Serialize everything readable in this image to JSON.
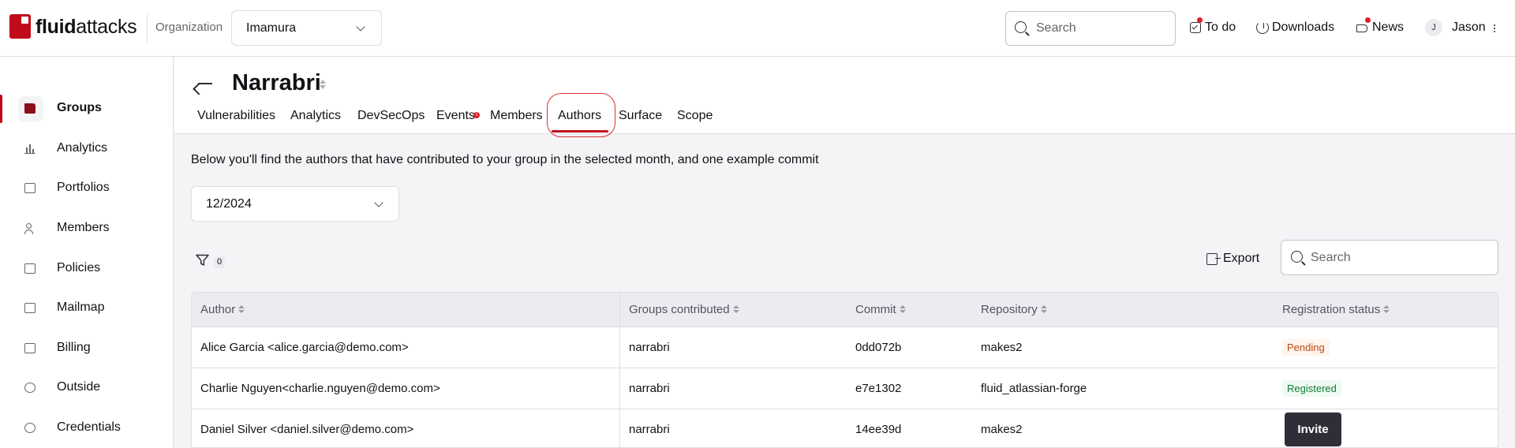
{
  "topbar": {
    "logo_bold": "fluid",
    "logo_light": "attacks",
    "org_label": "Organization",
    "org_value": "Imamura",
    "search_placeholder": "Search",
    "todo_label": "To do",
    "downloads_label": "Downloads",
    "news_label": "News",
    "user_initial": "J",
    "user_name": "Jason"
  },
  "sidebar": {
    "items": [
      {
        "label": "Groups",
        "icon": "folder-icon"
      },
      {
        "label": "Analytics",
        "icon": "bar-chart-icon"
      },
      {
        "label": "Portfolios",
        "icon": "briefcase-icon"
      },
      {
        "label": "Members",
        "icon": "user-plus-icon"
      },
      {
        "label": "Policies",
        "icon": "document-icon"
      },
      {
        "label": "Mailmap",
        "icon": "mail-icon"
      },
      {
        "label": "Billing",
        "icon": "credit-card-icon"
      },
      {
        "label": "Outside",
        "icon": "info-icon"
      },
      {
        "label": "Credentials",
        "icon": "key-icon"
      }
    ]
  },
  "group": {
    "title": "Narrabri",
    "tabs": [
      "Vulnerabilities",
      "Analytics",
      "DevSecOps",
      "Events",
      "Members",
      "Authors",
      "Surface",
      "Scope"
    ],
    "active_tab": "Authors",
    "events_badge": "1"
  },
  "authors": {
    "description": "Below you'll find the authors that have contributed to your group in the selected month, and one example commit",
    "month": "12/2024",
    "filter_count": "0",
    "export_label": "Export",
    "search_placeholder": "Search",
    "columns": [
      "Author",
      "Groups contributed",
      "Commit",
      "Repository",
      "Registration status"
    ],
    "rows": [
      {
        "author": "Alice Garcia <alice.garcia@demo.com>",
        "groups": "narrabri",
        "commit": "0dd072b",
        "repository": "makes2",
        "status": "Pending"
      },
      {
        "author": "Charlie Nguyen<charlie.nguyen@demo.com>",
        "groups": "narrabri",
        "commit": "e7e1302",
        "repository": "fluid_atlassian-forge",
        "status": "Registered"
      },
      {
        "author": "Daniel Silver <daniel.silver@demo.com>",
        "groups": "narrabri",
        "commit": "14ee39d",
        "repository": "makes2",
        "status": "Invite"
      }
    ]
  },
  "colors": {
    "brand_red": "#bf0b1a",
    "dark_button": "#2e2e38",
    "pending": "#bf4a0b",
    "registered": "#137c3a"
  }
}
